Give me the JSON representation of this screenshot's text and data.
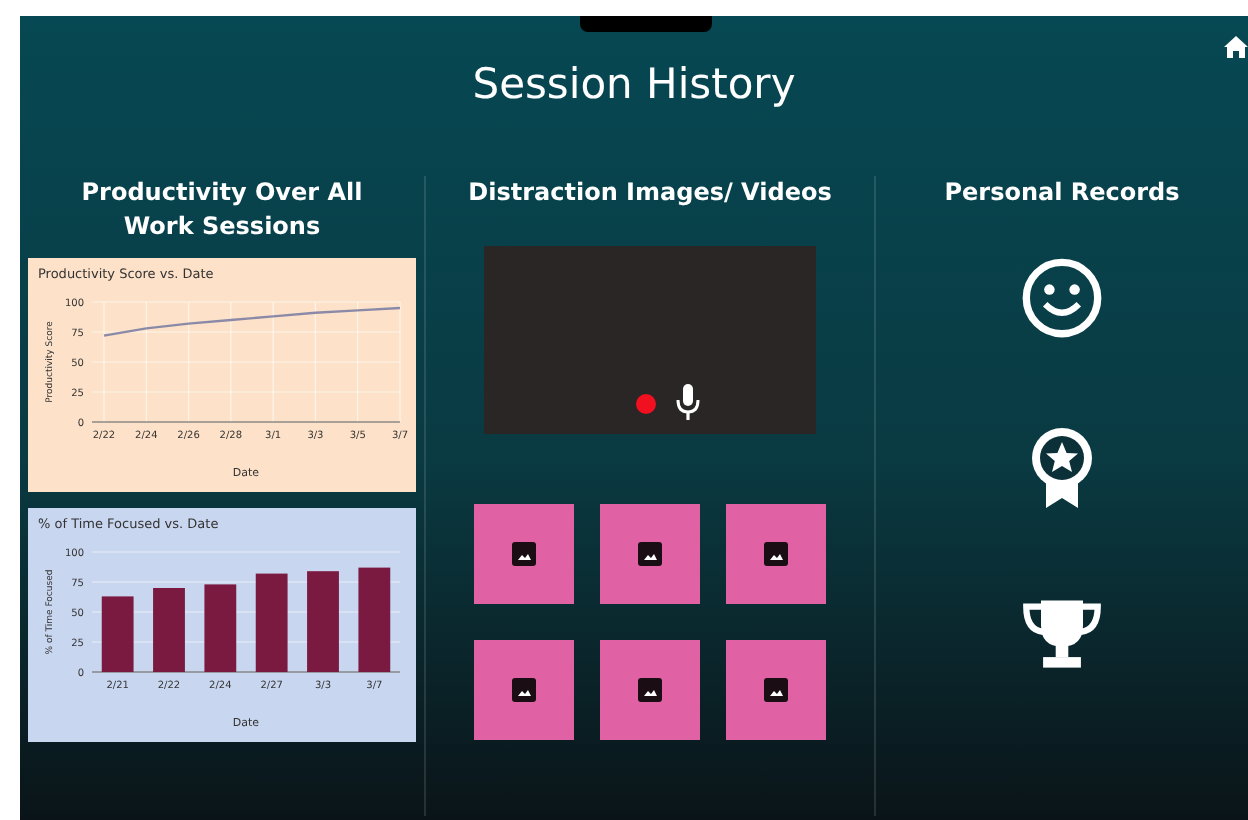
{
  "title": "Session History",
  "productivity": {
    "heading": "Productivity Over All Work Sessions",
    "charts": [
      {
        "chart_data": {
          "type": "line",
          "title": "Productivity Score vs. Date",
          "xlabel": "Date",
          "ylabel": "Productivity Score",
          "categories": [
            "2/22",
            "2/24",
            "2/26",
            "2/28",
            "3/1",
            "3/3",
            "3/5",
            "3/7"
          ],
          "values": [
            72,
            78,
            82,
            85,
            88,
            91,
            93,
            95
          ],
          "grid": true,
          "ylim": [
            0,
            100
          ],
          "yticks": [
            0,
            25,
            50,
            75,
            100
          ]
        }
      },
      {
        "chart_data": {
          "type": "bar",
          "title": "% of Time Focused vs. Date",
          "xlabel": "Date",
          "ylabel": "% of Time Focused",
          "categories": [
            "2/21",
            "2/22",
            "2/24",
            "2/27",
            "3/3",
            "3/7"
          ],
          "values": [
            63,
            70,
            73,
            82,
            84,
            87
          ],
          "grid": true,
          "ylim": [
            0,
            100
          ],
          "yticks": [
            0,
            25,
            50,
            75,
            100
          ]
        }
      }
    ]
  },
  "distraction": {
    "heading": "Distraction Images/ Videos",
    "media": [
      {
        "kind": "image"
      },
      {
        "kind": "image"
      },
      {
        "kind": "image"
      },
      {
        "kind": "image"
      },
      {
        "kind": "image"
      },
      {
        "kind": "image"
      }
    ]
  },
  "records": {
    "heading": "Personal Records",
    "items": [
      {
        "kind": "smiley"
      },
      {
        "kind": "medal"
      },
      {
        "kind": "trophy"
      }
    ]
  }
}
